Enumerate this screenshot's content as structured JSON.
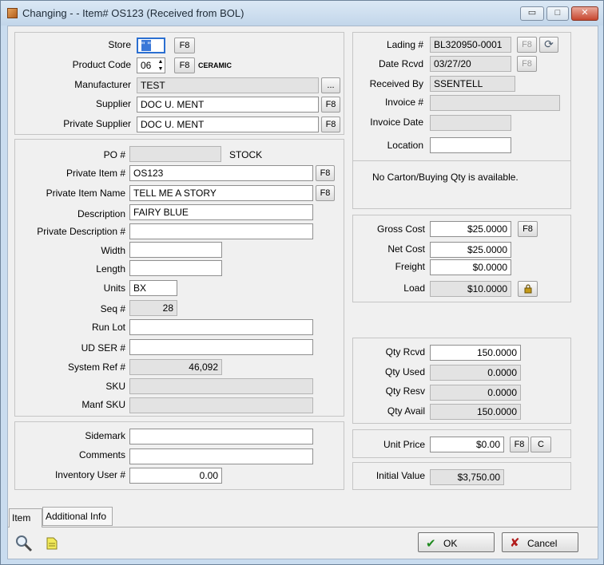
{
  "window": {
    "title": "Changing - - Item# OS123  (Received from BOL)",
    "minimize": "▭",
    "maximize": "□",
    "close": "✕"
  },
  "store": {
    "label": "Store",
    "value": "\" \"",
    "f8": "F8"
  },
  "product_code": {
    "label": "Product Code",
    "value": "06",
    "f8": "F8",
    "desc": "CERAMIC"
  },
  "manufacturer": {
    "label": "Manufacturer",
    "value": "TEST",
    "browse": "..."
  },
  "supplier": {
    "label": "Supplier",
    "value": "DOC U. MENT",
    "f8": "F8"
  },
  "private_supplier": {
    "label": "Private Supplier",
    "value": "DOC U. MENT",
    "f8": "F8"
  },
  "po": {
    "label": "PO #",
    "value": "",
    "note": "STOCK"
  },
  "private_item": {
    "label": "Private Item #",
    "value": "OS123",
    "f8": "F8"
  },
  "private_item_name": {
    "label": "Private Item Name",
    "value": "TELL ME A STORY",
    "f8": "F8"
  },
  "description": {
    "label": "Description",
    "value": "FAIRY BLUE"
  },
  "private_description": {
    "label": "Private Description #",
    "value": ""
  },
  "width": {
    "label": "Width",
    "value": ""
  },
  "length": {
    "label": "Length",
    "value": ""
  },
  "units": {
    "label": "Units",
    "value": "BX"
  },
  "seq": {
    "label": "Seq #",
    "value": "28"
  },
  "run_lot": {
    "label": "Run Lot",
    "value": ""
  },
  "ud_ser": {
    "label": "UD SER #",
    "value": ""
  },
  "system_ref": {
    "label": "System Ref #",
    "value": "46,092"
  },
  "sku": {
    "label": "SKU",
    "value": ""
  },
  "manf_sku": {
    "label": "Manf SKU",
    "value": ""
  },
  "sidemark": {
    "label": "Sidemark",
    "value": ""
  },
  "comments": {
    "label": "Comments",
    "value": ""
  },
  "inventory_user": {
    "label": "Inventory User #",
    "value": "0.00"
  },
  "lading": {
    "label": "Lading #",
    "value": "BL320950-0001",
    "f8": "F8"
  },
  "date_rcvd": {
    "label": "Date Rcvd",
    "value": "03/27/20",
    "f8": "F8"
  },
  "received_by": {
    "label": "Received By",
    "value": "SSENTELL"
  },
  "invoice": {
    "label": "Invoice #",
    "value": ""
  },
  "invoice_date": {
    "label": "Invoice Date",
    "value": ""
  },
  "location": {
    "label": "Location",
    "value": ""
  },
  "carton_note": "No Carton/Buying Qty is available.",
  "gross_cost": {
    "label": "Gross Cost",
    "value": "$25.0000",
    "f8": "F8"
  },
  "net_cost": {
    "label": "Net Cost",
    "value": "$25.0000"
  },
  "freight": {
    "label": "Freight",
    "value": "$0.0000"
  },
  "load": {
    "label": "Load",
    "value": "$10.0000"
  },
  "qty_rcvd": {
    "label": "Qty Rcvd",
    "value": "150.0000"
  },
  "qty_used": {
    "label": "Qty Used",
    "value": "0.0000"
  },
  "qty_resv": {
    "label": "Qty Resv",
    "value": "0.0000"
  },
  "qty_avail": {
    "label": "Qty Avail",
    "value": "150.0000"
  },
  "unit_price": {
    "label": "Unit Price",
    "value": "$0.00",
    "f8": "F8",
    "c": "C"
  },
  "initial_value": {
    "label": "Initial Value",
    "value": "$3,750.00"
  },
  "tabs": [
    "Item",
    "Additional Info"
  ],
  "buttons": {
    "ok": "OK",
    "cancel": "Cancel"
  },
  "icons": {
    "app": "app-icon",
    "search": "magnifier-icon",
    "notes": "note-icon",
    "refresh": "refresh-icon",
    "lock": "lock-icon"
  }
}
